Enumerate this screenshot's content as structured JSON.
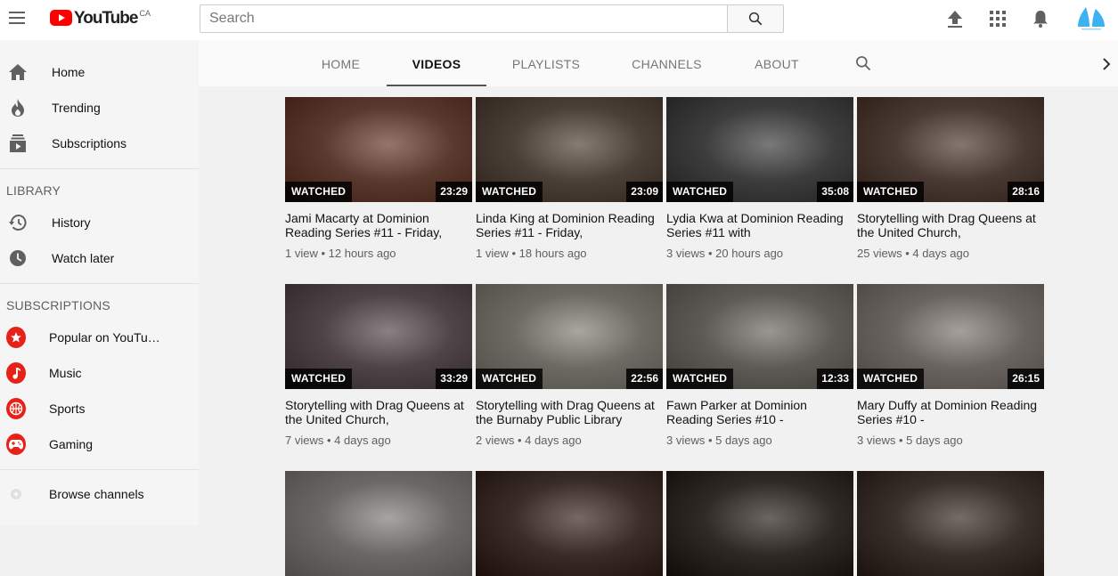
{
  "header": {
    "logo_text": "YouTube",
    "logo_region": "CA",
    "search_placeholder": "Search"
  },
  "sidebar": {
    "main": [
      {
        "label": "Home",
        "icon": "home-icon"
      },
      {
        "label": "Trending",
        "icon": "flame-icon"
      },
      {
        "label": "Subscriptions",
        "icon": "subscriptions-icon"
      }
    ],
    "library_heading": "LIBRARY",
    "library": [
      {
        "label": "History",
        "icon": "history-icon"
      },
      {
        "label": "Watch later",
        "icon": "clock-icon"
      }
    ],
    "subscriptions_heading": "SUBSCRIPTIONS",
    "subscriptions": [
      {
        "label": "Popular on YouTu…",
        "icon": "star-icon"
      },
      {
        "label": "Music",
        "icon": "music-note-icon"
      },
      {
        "label": "Sports",
        "icon": "ball-icon"
      },
      {
        "label": "Gaming",
        "icon": "gamepad-icon"
      }
    ],
    "browse": {
      "label": "Browse channels",
      "icon": "plus-circle-icon"
    }
  },
  "tabs": [
    {
      "label": "HOME"
    },
    {
      "label": "VIDEOS",
      "active": true
    },
    {
      "label": "PLAYLISTS"
    },
    {
      "label": "CHANNELS"
    },
    {
      "label": "ABOUT"
    }
  ],
  "colors": {
    "accent_red": "#ff0000",
    "subscription_red": "#e62117",
    "avatar_blue": "#3cb3f0"
  },
  "videos": [
    {
      "title": "Jami Macarty at Dominion Reading Series #11 - Friday,",
      "views": "1 view",
      "age": "12 hours ago",
      "duration": "23:29",
      "watched_label": "WATCHED",
      "tone": "#5a3a2e"
    },
    {
      "title": "Linda King at Dominion Reading Series #11 - Friday,",
      "views": "1 view",
      "age": "18 hours ago",
      "duration": "23:09",
      "watched_label": "WATCHED",
      "tone": "#4a4038"
    },
    {
      "title": "Lydia Kwa at Dominion Reading Series #11 with",
      "views": "3 views",
      "age": "20 hours ago",
      "duration": "35:08",
      "watched_label": "WATCHED",
      "tone": "#3d3d3d"
    },
    {
      "title": "Storytelling with Drag Queens at the United Church,",
      "views": "25 views",
      "age": "4 days ago",
      "duration": "28:16",
      "watched_label": "WATCHED",
      "tone": "#4a3a34"
    },
    {
      "title": "Storytelling with Drag Queens at the United Church,",
      "views": "7 views",
      "age": "4 days ago",
      "duration": "33:29",
      "watched_label": "WATCHED",
      "tone": "#4e4448"
    },
    {
      "title": "Storytelling with Drag Queens at the Burnaby Public Library",
      "views": "2 views",
      "age": "4 days ago",
      "duration": "22:56",
      "watched_label": "WATCHED",
      "tone": "#6d6a64"
    },
    {
      "title": "Fawn Parker at Dominion Reading Series #10 -",
      "views": "3 views",
      "age": "5 days ago",
      "duration": "12:33",
      "watched_label": "WATCHED",
      "tone": "#5e5a55"
    },
    {
      "title": "Mary Duffy at Dominion Reading Series #10 -",
      "views": "3 views",
      "age": "5 days ago",
      "duration": "26:15",
      "watched_label": "WATCHED",
      "tone": "#6a6460"
    },
    {
      "tone": "#6b6965"
    },
    {
      "tone": "#3a2c26"
    },
    {
      "tone": "#2f2a26"
    },
    {
      "tone": "#3a302b"
    }
  ]
}
